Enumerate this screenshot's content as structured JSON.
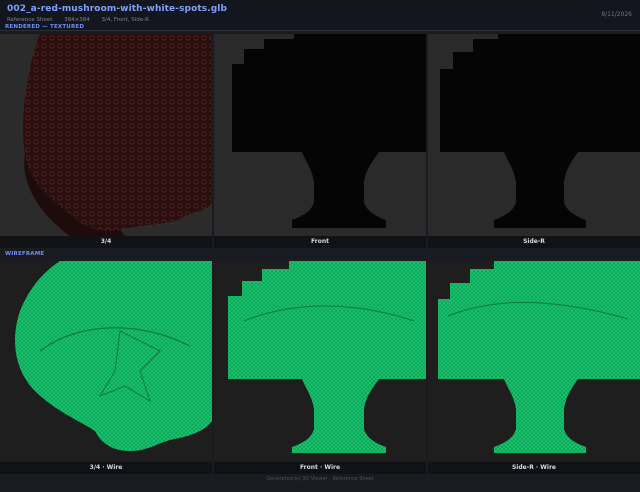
{
  "header": {
    "title": "002_a-red-mushroom-with-white-spots.glb",
    "subtitle_parts": [
      "Reference Sheet",
      "384×384",
      "3/4, Front, Side-R"
    ],
    "date": "8/11/2026"
  },
  "sections": {
    "rendered_label": "RENDERED — TEXTURED",
    "wireframe_label": "WIREFRAME"
  },
  "panels": {
    "rendered": [
      {
        "caption": "3/4"
      },
      {
        "caption": "Front"
      },
      {
        "caption": "Side-R"
      }
    ],
    "wireframe": [
      {
        "caption": "3/4 · Wire"
      },
      {
        "caption": "Front · Wire"
      },
      {
        "caption": "Side-R · Wire"
      }
    ]
  },
  "footer": "Generated by 3D Viewer · Reference Sheet",
  "colors": {
    "accent": "#7fa0ff",
    "wire_green": "#1fd47a",
    "model_dark": "#050505",
    "cap_red": "#3a1414"
  }
}
